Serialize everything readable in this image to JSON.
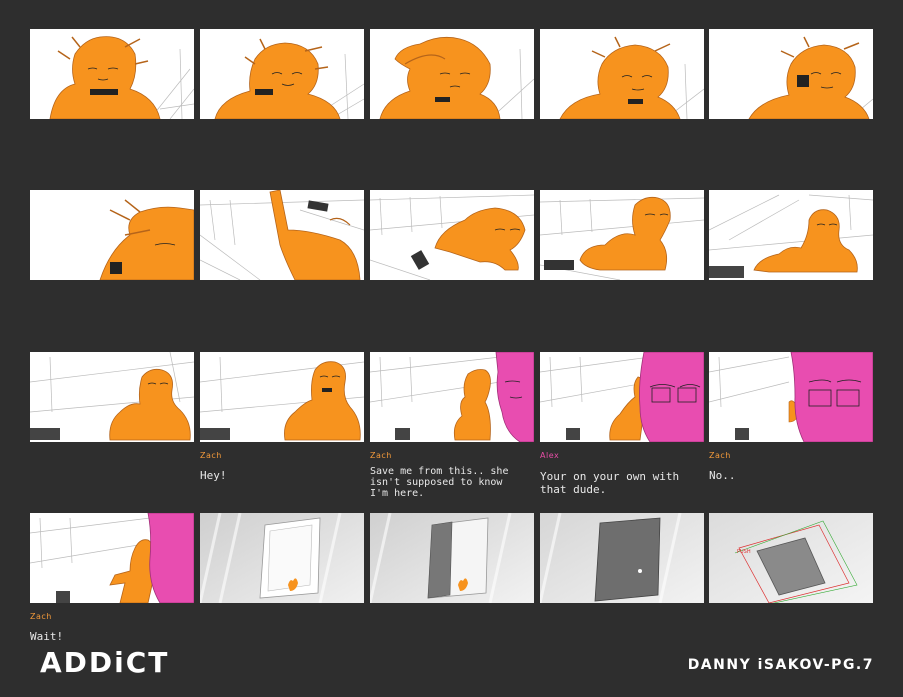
{
  "title": "ADDiCT",
  "credit": "DANNY iSAKOV-PG.7",
  "colors": {
    "background": "#2e2e2e",
    "zach_fill": "#f7931e",
    "alex_fill": "#e84db0",
    "zach_label": "#f39a3a",
    "alex_label": "#e64da5"
  },
  "captions": [
    {
      "panel": "r3c2",
      "speaker": "Zach",
      "line": "Hey!"
    },
    {
      "panel": "r3c3",
      "speaker": "Zach",
      "line": "Save me from this.. she isn't supposed to know I'm here."
    },
    {
      "panel": "r3c4",
      "speaker": "Alex",
      "line": "Your on your own with that dude."
    },
    {
      "panel": "r3c5",
      "speaker": "Zach",
      "line": "No.."
    },
    {
      "panel": "r4c1",
      "speaker": "Zach",
      "line": "Wait!"
    }
  ],
  "panels": [
    {
      "id": "r1c1",
      "icon": "zach-closeup-sketch"
    },
    {
      "id": "r1c2",
      "icon": "zach-closeup-sketch"
    },
    {
      "id": "r1c3",
      "icon": "zach-hand-on-head-sketch"
    },
    {
      "id": "r1c4",
      "icon": "zach-closeup-sketch"
    },
    {
      "id": "r1c5",
      "icon": "zach-closeup-sketch"
    },
    {
      "id": "r2c1",
      "icon": "zach-extreme-closeup-sketch"
    },
    {
      "id": "r2c2",
      "icon": "zach-reaching-sketch"
    },
    {
      "id": "r2c3",
      "icon": "zach-crawling-sketch"
    },
    {
      "id": "r2c4",
      "icon": "zach-sitting-sketch"
    },
    {
      "id": "r2c5",
      "icon": "zach-sitting-sketch"
    },
    {
      "id": "r3c1",
      "icon": "zach-sitting-sketch"
    },
    {
      "id": "r3c2",
      "icon": "zach-sitting-sketch"
    },
    {
      "id": "r3c3",
      "icon": "zach-and-alex-sketch"
    },
    {
      "id": "r3c4",
      "icon": "zach-and-alex-sketch"
    },
    {
      "id": "r3c5",
      "icon": "alex-closeup-sketch"
    },
    {
      "id": "r4c1",
      "icon": "zach-running-sketch"
    },
    {
      "id": "r4c2",
      "icon": "open-door-sketch"
    },
    {
      "id": "r4c3",
      "icon": "closing-door-sketch"
    },
    {
      "id": "r4c4",
      "icon": "closed-door-sketch"
    },
    {
      "id": "r4c5",
      "icon": "tilted-door-sketch"
    }
  ]
}
